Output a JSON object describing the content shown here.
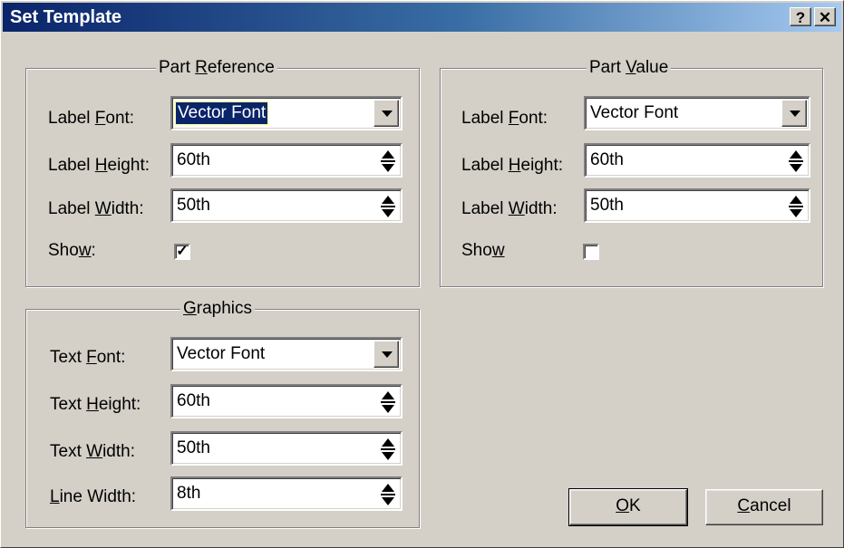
{
  "window": {
    "title": "Set Template",
    "help_glyph": "?",
    "close_glyph": "✕"
  },
  "part_reference": {
    "legend_pre": "Part ",
    "legend_key": "R",
    "legend_post": "eference",
    "font": {
      "pre": "Label ",
      "key": "F",
      "post": "ont:",
      "value": "Vector Font"
    },
    "height": {
      "pre": "Label ",
      "key": "H",
      "post": "eight:",
      "value": "60th"
    },
    "width": {
      "pre": "Label ",
      "key": "W",
      "post": "idth:",
      "value": "50th"
    },
    "show": {
      "pre": "Sho",
      "key": "w",
      "post": ":",
      "checked": true,
      "mark": "✓"
    }
  },
  "part_value": {
    "legend_pre": "Part ",
    "legend_key": "V",
    "legend_post": "alue",
    "font": {
      "pre": "Label ",
      "key": "F",
      "post": "ont:",
      "value": "Vector Font"
    },
    "height": {
      "pre": "Label ",
      "key": "H",
      "post": "eight:",
      "value": "60th"
    },
    "width": {
      "pre": "Label ",
      "key": "W",
      "post": "idth:",
      "value": "50th"
    },
    "show": {
      "pre": "Sho",
      "key": "w",
      "post": "",
      "checked": false,
      "mark": ""
    }
  },
  "graphics": {
    "legend_pre": "",
    "legend_key": "G",
    "legend_post": "raphics",
    "font": {
      "pre": "Text ",
      "key": "F",
      "post": "ont:",
      "value": "Vector Font"
    },
    "height": {
      "pre": "Text ",
      "key": "H",
      "post": "eight:",
      "value": "60th"
    },
    "width": {
      "pre": "Text ",
      "key": "W",
      "post": "idth:",
      "value": "50th"
    },
    "line_width": {
      "pre": "",
      "key": "L",
      "post": "ine Width:",
      "value": "8th"
    }
  },
  "buttons": {
    "ok": {
      "key": "O",
      "post": "K"
    },
    "cancel": {
      "key": "C",
      "post": "ancel"
    }
  },
  "colors": {
    "face": "#d4d0c8",
    "title_start": "#0a246a",
    "title_end": "#a6caf0"
  }
}
